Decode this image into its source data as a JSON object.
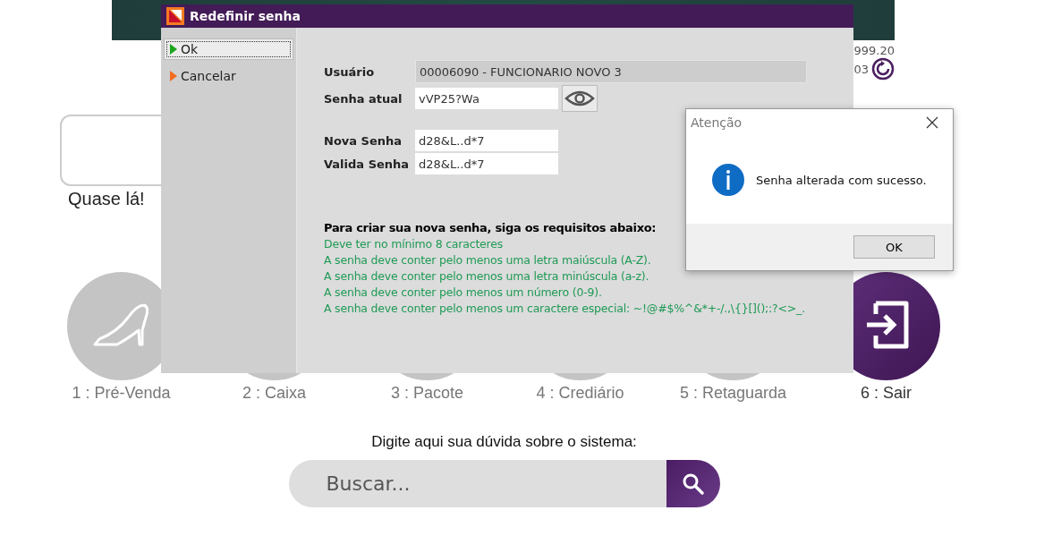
{
  "background_page": {
    "version": "999.20",
    "version_line_2": "03",
    "card_caption": "Quase lá!",
    "modules": [
      {
        "label": "1 : Pré-Venda",
        "selected": false
      },
      {
        "label": "2 : Caixa",
        "selected": false
      },
      {
        "label": "3 : Pacote",
        "selected": false
      },
      {
        "label": "4 : Crediário",
        "selected": false
      },
      {
        "label": "5 : Retaguarda",
        "selected": false
      },
      {
        "label": "6 : Sair",
        "selected": true
      }
    ],
    "search": {
      "label": "Digite aqui sua dúvida sobre o sistema:",
      "placeholder": "Buscar..."
    }
  },
  "dialog": {
    "title": "Redefinir senha",
    "actions": [
      {
        "label": "Ok",
        "focused": true
      },
      {
        "label": "Cancelar",
        "focused": false
      }
    ],
    "fields": [
      {
        "label": "Usuário",
        "value": "00006090 - FUNCIONARIO NOVO 3",
        "disabled": true,
        "reveal_button": false
      },
      {
        "label": "Senha atual",
        "value": "vVP25?Wa",
        "disabled": false,
        "reveal_button": true
      },
      {
        "label": "Nova Senha",
        "value": "d28&L..d*7",
        "disabled": false,
        "reveal_button": false
      },
      {
        "label": "Valida Senha",
        "value": "d28&L..d*7",
        "disabled": false,
        "reveal_button": false
      }
    ],
    "requirements_title": "Para criar sua nova senha, siga os requisitos abaixo:",
    "requirements": [
      {
        "text": "Deve ter no mínimo 8 caracteres",
        "met": true
      },
      {
        "text": "A senha deve conter pelo menos uma letra maiúscula (A-Z).",
        "met": true
      },
      {
        "text": "A senha deve conter pelo menos uma letra minúscula (a-z).",
        "met": true
      },
      {
        "text": "A senha deve conter pelo menos um número (0-9).",
        "met": true
      },
      {
        "text": "A senha deve conter pelo menos um caractere especial: ~!@#$%^&*+-/.,\\{}[]();:?<>_.",
        "met": true
      }
    ]
  },
  "alert": {
    "title": "Atenção",
    "message": "Senha alterada com sucesso.",
    "button": "OK"
  }
}
